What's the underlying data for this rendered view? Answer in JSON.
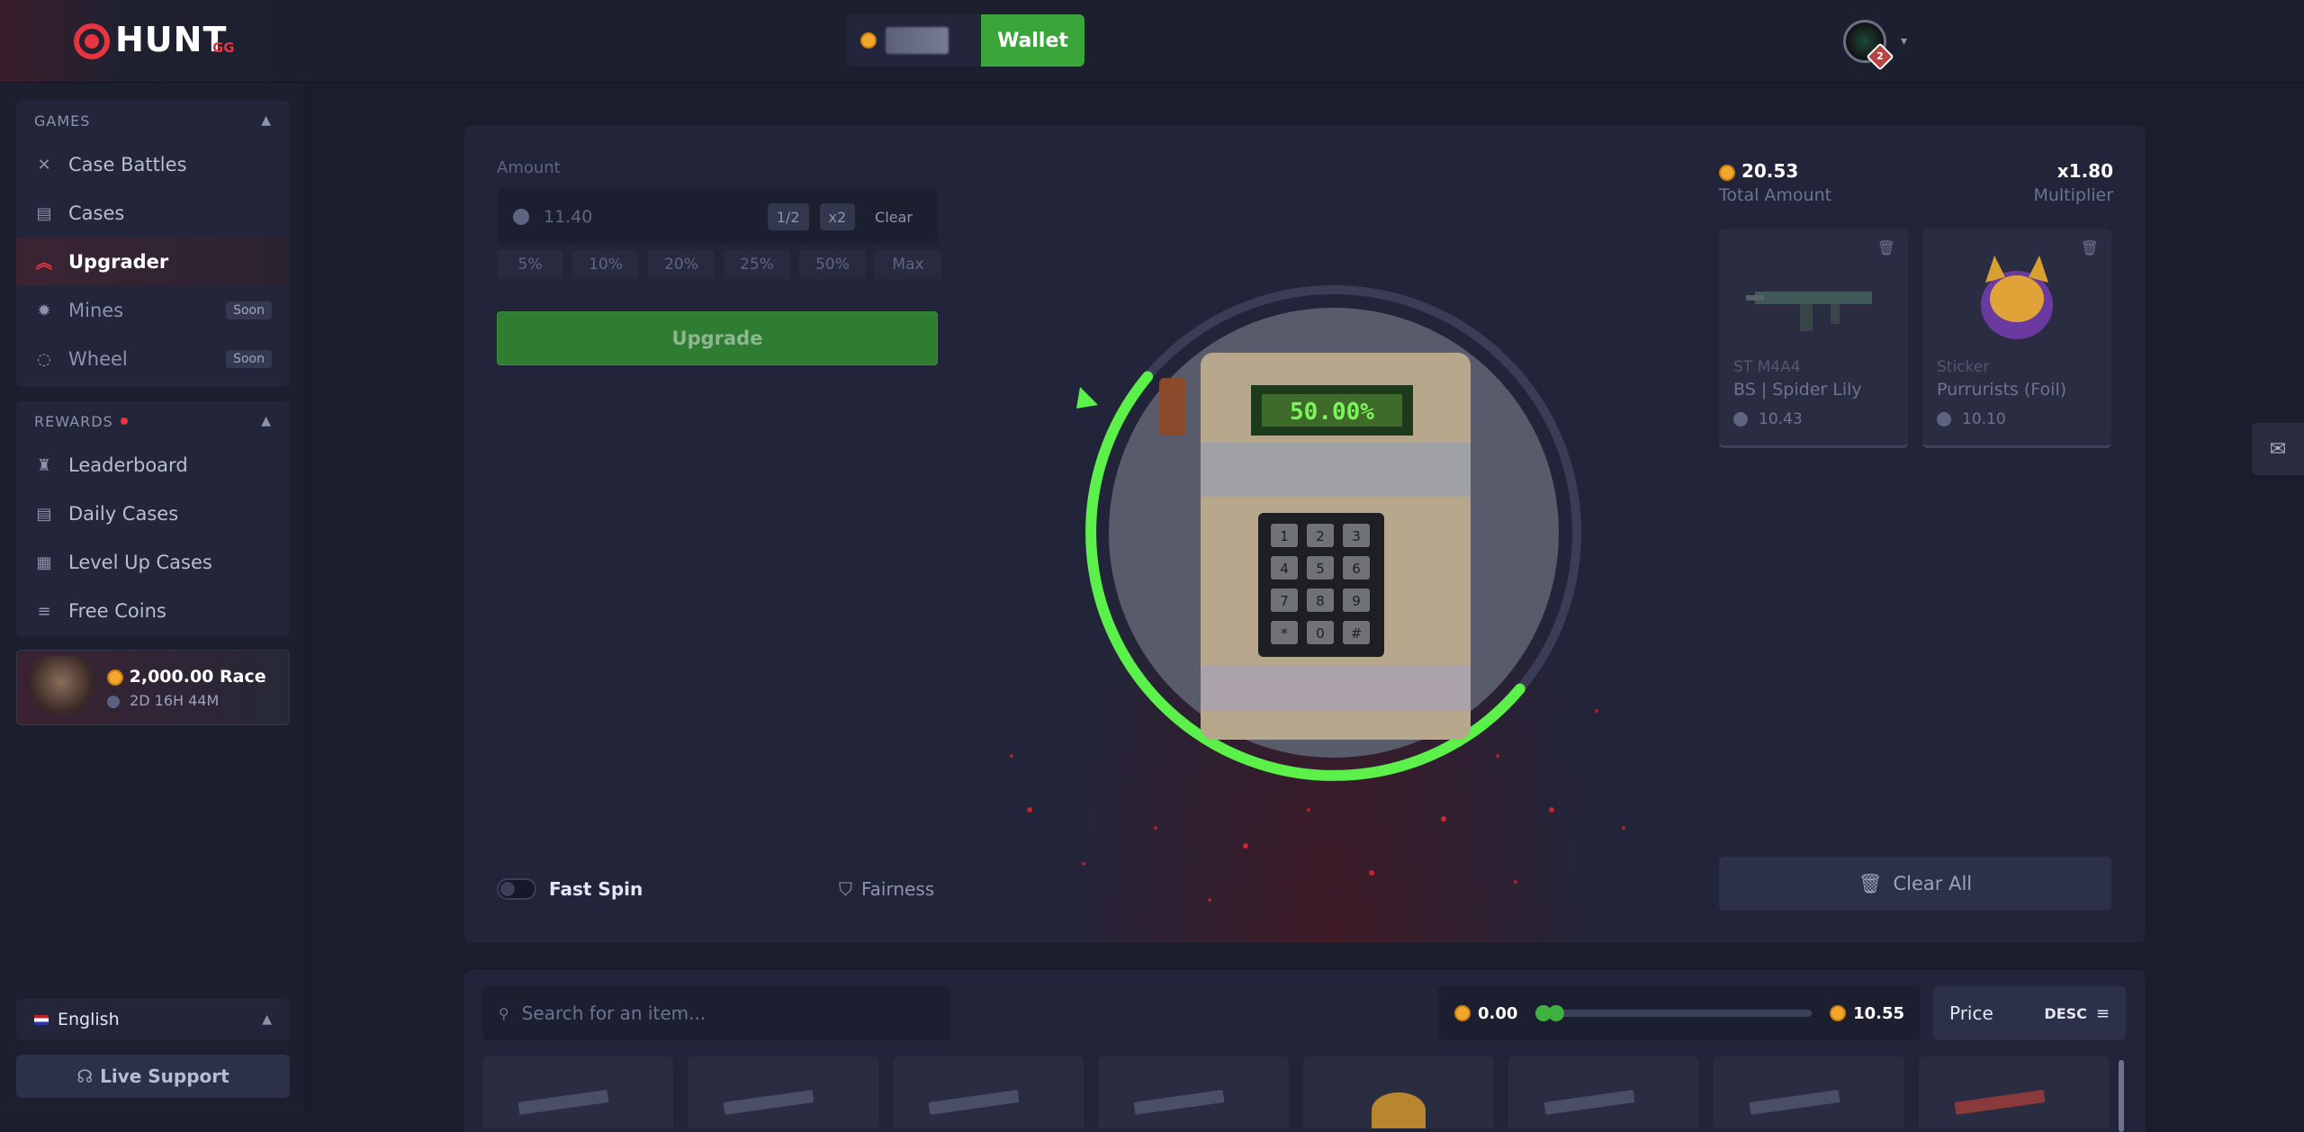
{
  "brand": {
    "name": "HUNT",
    "suffix": "GG"
  },
  "games": {
    "heading": "GAMES",
    "items": [
      {
        "label": "Case Battles",
        "icon": "crossed-swords-icon"
      },
      {
        "label": "Cases",
        "icon": "case-icon"
      },
      {
        "label": "Upgrader",
        "icon": "chevron-up-double-icon"
      },
      {
        "label": "Mines",
        "icon": "mine-icon",
        "badge": "Soon"
      },
      {
        "label": "Wheel",
        "icon": "wheel-icon",
        "badge": "Soon"
      }
    ]
  },
  "rewards": {
    "heading": "REWARDS",
    "items": [
      {
        "label": "Leaderboard",
        "icon": "trophy-icon"
      },
      {
        "label": "Daily Cases",
        "icon": "case-icon"
      },
      {
        "label": "Level Up Cases",
        "icon": "level-icon"
      },
      {
        "label": "Free Coins",
        "icon": "coins-icon"
      }
    ]
  },
  "race": {
    "amount": "2,000.00",
    "label": "Race",
    "timer": "2D 16H 44M"
  },
  "language": {
    "label": "English"
  },
  "support": {
    "label": "Live Support"
  },
  "wallet": {
    "label": "Wallet"
  },
  "user": {
    "level": "2"
  },
  "upgrader": {
    "amount_label": "Amount",
    "amount_value": "11.40",
    "half_label": "1/2",
    "double_label": "x2",
    "clear_label": "Clear",
    "percents": [
      "5%",
      "10%",
      "20%",
      "25%",
      "50%",
      "Max"
    ],
    "upgrade_label": "Upgrade",
    "fast_spin_label": "Fast Spin",
    "fairness_label": "Fairness",
    "chance": "50.00%",
    "chance_fraction": 0.5,
    "keypad": [
      "1",
      "2",
      "3",
      "4",
      "5",
      "6",
      "7",
      "8",
      "9",
      "*",
      "0",
      "#"
    ]
  },
  "selection": {
    "total_amount": "20.53",
    "total_label": "Total Amount",
    "multiplier": "x1.80",
    "multiplier_label": "Multiplier",
    "items": [
      {
        "subtitle": "ST M4A4",
        "name": "BS | Spider Lily",
        "price": "10.43"
      },
      {
        "subtitle": "Sticker",
        "name": "Purrurists (Foil)",
        "price": "10.10"
      }
    ],
    "clear_all_label": "Clear All"
  },
  "inventory": {
    "search_placeholder": "Search for an item...",
    "price_min": "0.00",
    "price_max": "10.55",
    "sort_label": "Price",
    "sort_dir": "DESC"
  },
  "colors": {
    "accent": "#e8343f",
    "green": "#3aa538",
    "ring": "#5cf04a"
  }
}
